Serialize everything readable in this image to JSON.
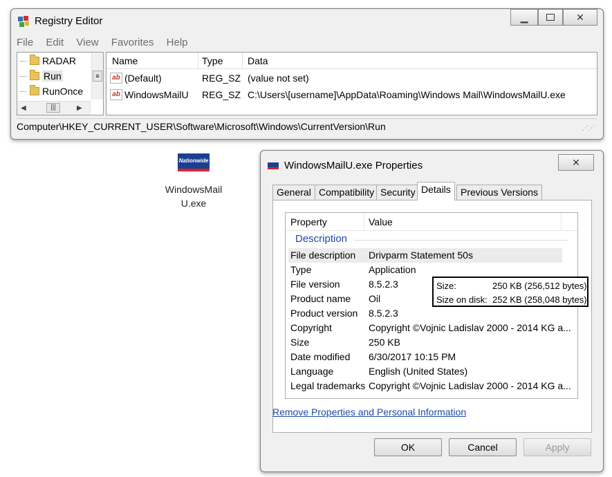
{
  "regedit": {
    "title": "Registry Editor",
    "menu": [
      "File",
      "Edit",
      "View",
      "Favorites",
      "Help"
    ],
    "tree": [
      {
        "label": "RADAR"
      },
      {
        "label": "Run"
      },
      {
        "label": "RunOnce"
      }
    ],
    "columns": {
      "name": "Name",
      "type": "Type",
      "data": "Data"
    },
    "rows": [
      {
        "name": "(Default)",
        "type": "REG_SZ",
        "data": "(value not set)"
      },
      {
        "name": "WindowsMailU",
        "type": "REG_SZ",
        "data": "C:\\Users\\[username]\\AppData\\Roaming\\Windows Mail\\WindowsMailU.exe"
      }
    ],
    "status": "Computer\\HKEY_CURRENT_USER\\Software\\Microsoft\\Windows\\CurrentVersion\\Run"
  },
  "desktop_icon": {
    "logo_text": "Nationwide",
    "label_line1": "WindowsMail",
    "label_line2": "U.exe"
  },
  "props": {
    "title": "WindowsMailU.exe Properties",
    "tabs": [
      "General",
      "Compatibility",
      "Security",
      "Details",
      "Previous Versions"
    ],
    "active_tab": "Details",
    "col_property": "Property",
    "col_value": "Value",
    "group": "Description",
    "rows": [
      {
        "property": "File description",
        "value": "Drivparm Statement 50s"
      },
      {
        "property": "Type",
        "value": "Application"
      },
      {
        "property": "File version",
        "value": "8.5.2.3"
      },
      {
        "property": "Product name",
        "value": "Oil"
      },
      {
        "property": "Product version",
        "value": "8.5.2.3"
      },
      {
        "property": "Copyright",
        "value": "Copyright ©Vojnic Ladislav 2000 - 2014 KG a..."
      },
      {
        "property": "Size",
        "value": "250 KB"
      },
      {
        "property": "Date modified",
        "value": "6/30/2017 10:15 PM"
      },
      {
        "property": "Language",
        "value": "English (United States)"
      },
      {
        "property": "Legal trademarks",
        "value": "Copyright ©Vojnic Ladislav 2000 - 2014 KG a..."
      }
    ],
    "link": "Remove Properties and Personal Information",
    "buttons": {
      "ok": "OK",
      "cancel": "Cancel",
      "apply": "Apply"
    }
  },
  "size_callout": {
    "size_label": "Size:",
    "size_value": "250 KB (256,512 bytes)",
    "disk_label": "Size on disk:",
    "disk_value": "252 KB (258,048 bytes)"
  }
}
